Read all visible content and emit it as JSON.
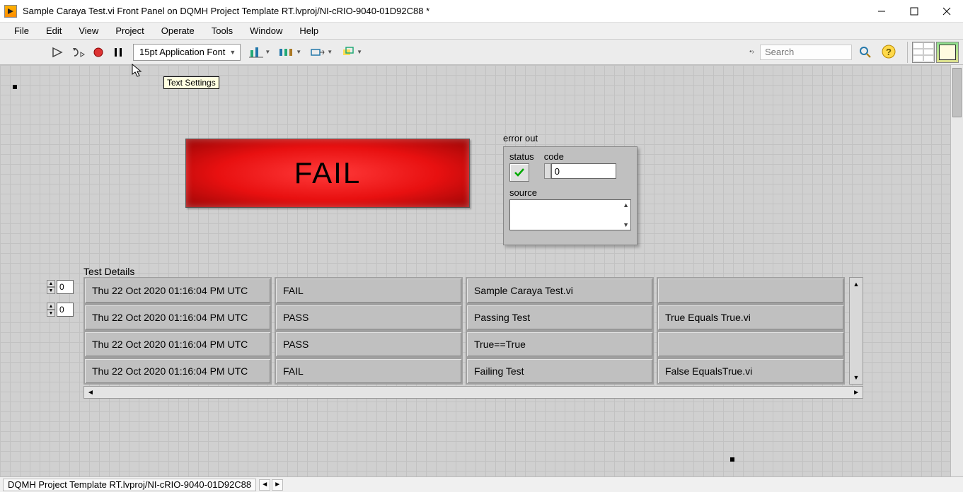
{
  "window": {
    "title": "Sample Caraya Test.vi Front Panel on DQMH Project Template RT.lvproj/NI-cRIO-9040-01D92C88 *"
  },
  "menu": {
    "file": "File",
    "edit": "Edit",
    "view": "View",
    "project": "Project",
    "operate": "Operate",
    "tools": "Tools",
    "window": "Window",
    "help": "Help"
  },
  "toolbar": {
    "font_combo": "15pt Application Font",
    "search_placeholder": "Search",
    "tooltip": "Text Settings"
  },
  "fail_indicator": "FAIL",
  "error_out": {
    "label": "error out",
    "status_label": "status",
    "code_label": "code",
    "code_value": "0",
    "source_label": "source",
    "source_value": ""
  },
  "test_details": {
    "label": "Test Details",
    "index0": "0",
    "index1": "0",
    "rows": [
      {
        "ts": "Thu 22 Oct 2020 01:16:04 PM UTC",
        "result": "FAIL",
        "name": "Sample Caraya Test.vi",
        "extra": ""
      },
      {
        "ts": "Thu 22 Oct 2020 01:16:04 PM UTC",
        "result": "PASS",
        "name": " Passing Test",
        "extra": "True Equals True.vi"
      },
      {
        "ts": "Thu 22 Oct 2020 01:16:04 PM UTC",
        "result": "PASS",
        "name": "  True==True",
        "extra": ""
      },
      {
        "ts": "Thu 22 Oct 2020 01:16:04 PM UTC",
        "result": "FAIL",
        "name": " Failing Test",
        "extra": "False EqualsTrue.vi"
      }
    ]
  },
  "statusbar": {
    "project_path": "DQMH Project Template RT.lvproj/NI-cRIO-9040-01D92C88"
  }
}
